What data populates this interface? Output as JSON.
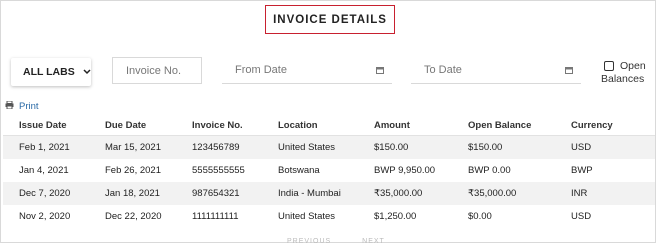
{
  "title": "INVOICE DETAILS",
  "filters": {
    "labs_label": "ALL LABS",
    "invoice_placeholder": "Invoice No.",
    "from_placeholder": "From Date",
    "to_placeholder": "To Date",
    "open_balances_line1": "Open",
    "open_balances_line2": "Balances"
  },
  "print_label": "Print",
  "table": {
    "headers": [
      "Issue Date",
      "Due Date",
      "Invoice No.",
      "Location",
      "Amount",
      "Open Balance",
      "Currency"
    ],
    "rows": [
      [
        "Feb 1, 2021",
        "Mar 15, 2021",
        "123456789",
        "United States",
        "$150.00",
        "$150.00",
        "USD"
      ],
      [
        "Jan 4, 2021",
        "Feb 26, 2021",
        "5555555555",
        "Botswana",
        "BWP 9,950.00",
        "BWP 0.00",
        "BWP"
      ],
      [
        "Dec 7, 2020",
        "Jan 18, 2021",
        "987654321",
        "India - Mumbai",
        "₹35,000.00",
        "₹35,000.00",
        "INR"
      ],
      [
        "Nov 2, 2020",
        "Dec 22, 2020",
        "1111111111",
        "United States",
        "$1,250.00",
        "$0.00",
        "USD"
      ]
    ]
  },
  "pager": {
    "previous": "PREVIOUS",
    "next": "NEXT"
  },
  "colors": {
    "title_border": "#c8202f",
    "link": "#2a6aa6",
    "row_alt": "#f2f2f2"
  }
}
